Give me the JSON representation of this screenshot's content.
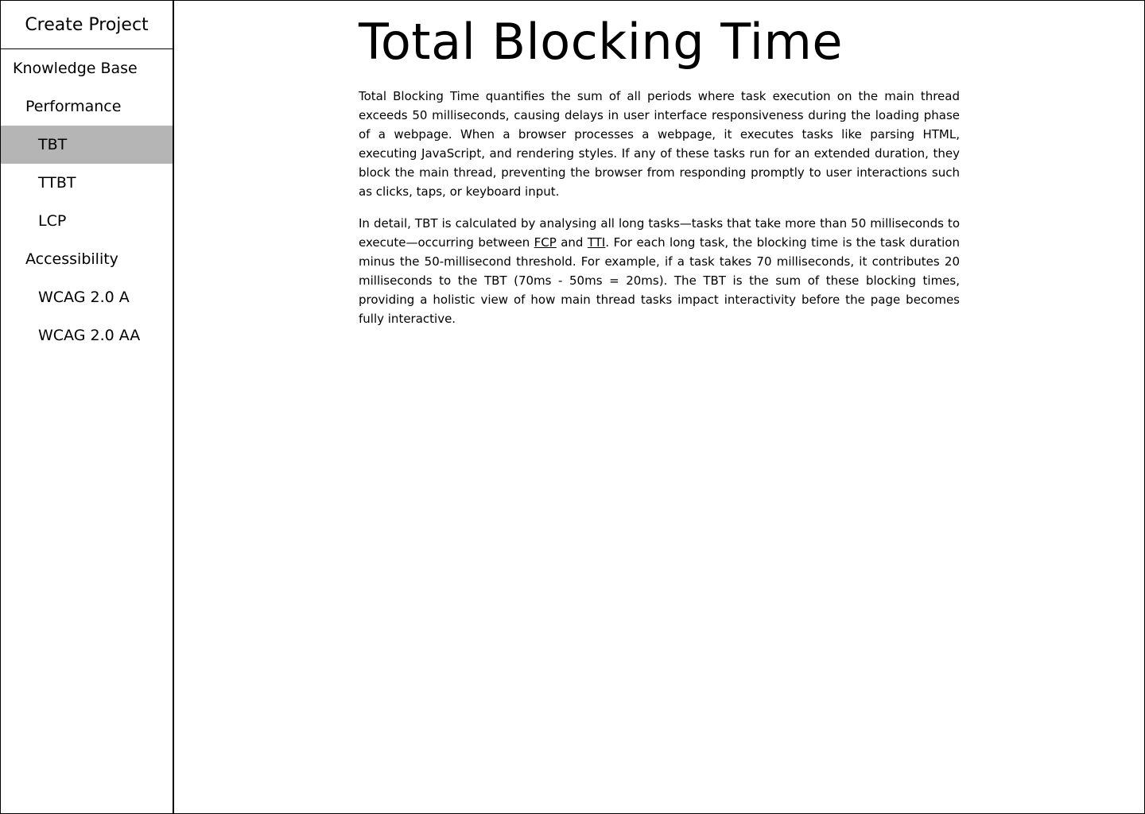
{
  "sidebar": {
    "create_project": "Create Project",
    "items": [
      {
        "label": "Knowledge Base"
      },
      {
        "label": "Performance"
      },
      {
        "label": "TBT"
      },
      {
        "label": "TTBT"
      },
      {
        "label": "LCP"
      },
      {
        "label": "Accessibility"
      },
      {
        "label": "WCAG 2.0 A"
      },
      {
        "label": "WCAG 2.0 AA"
      }
    ],
    "active_item": "TBT",
    "active_bg": "#b5b5b5"
  },
  "article": {
    "title": "Total Blocking Time",
    "p1": "Total Blocking Time quantifies the sum of all periods where task execution on the main thread exceeds 50 milliseconds, causing delays in user interface responsiveness during the loading phase of a webpage. When a browser processes a webpage, it executes tasks like parsing HTML, executing JavaScript, and rendering styles. If any of these tasks run for an extended duration, they block the main thread, preventing the browser from responding promptly to user interactions such as clicks, taps, or keyboard input.",
    "p2_a": "In detail, TBT is calculated by analysing all long tasks—tasks that take more than 50 milliseconds to execute—occurring between ",
    "link_fcp": "FCP",
    "p2_b": " and ",
    "link_tti": "TTI",
    "p2_c": ". For each long task, the blocking time is the task duration minus the 50-millisecond threshold. For example, if a task takes 70 milliseconds, it contributes 20 milliseconds to the TBT (70ms - 50ms = 20ms). The TBT is the sum of these blocking times, providing a holistic view of how main thread tasks impact interactivity before the page becomes fully interactive."
  }
}
